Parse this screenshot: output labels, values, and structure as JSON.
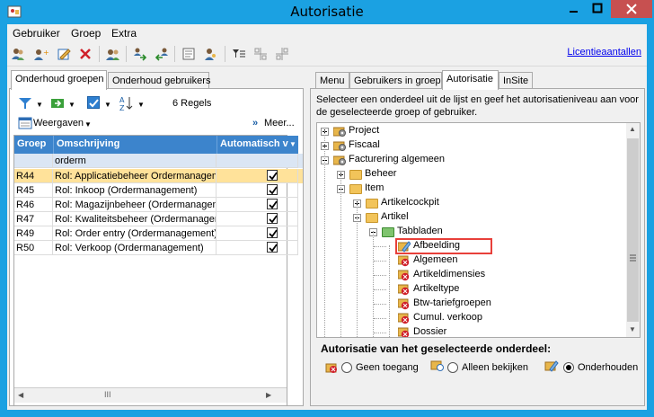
{
  "window": {
    "title": "Autorisatie"
  },
  "menu": {
    "items": [
      "Gebruiker",
      "Groep",
      "Extra"
    ]
  },
  "toolbar": {
    "license_link": "Licentieaantallen"
  },
  "left": {
    "tabs": [
      "Onderhoud groepen",
      "Onderhoud gebruikers"
    ],
    "row_count": "6 Regels",
    "views_label": "Weergaven",
    "more_label": "Meer...",
    "columns": [
      "Groep",
      "Omschrijving",
      "Automatisch v"
    ],
    "filter_value": "orderm",
    "rows": [
      {
        "code": "R44",
        "desc": "Rol: Applicatiebeheer Ordermanagement",
        "checked": true,
        "selected": true
      },
      {
        "code": "R45",
        "desc": "Rol: Inkoop (Ordermanagement)",
        "checked": true,
        "selected": false
      },
      {
        "code": "R46",
        "desc": "Rol: Magazijnbeheer (Ordermanagement)",
        "checked": true,
        "selected": false
      },
      {
        "code": "R47",
        "desc": "Rol: Kwaliteitsbeheer (Ordermanagement)",
        "checked": true,
        "selected": false
      },
      {
        "code": "R49",
        "desc": "Rol: Order entry (Ordermanagement)",
        "checked": true,
        "selected": false
      },
      {
        "code": "R50",
        "desc": "Rol: Verkoop (Ordermanagement)",
        "checked": true,
        "selected": false
      }
    ],
    "hscroll_grip": "III"
  },
  "right": {
    "tabs": [
      "Menu",
      "Gebruikers in groep",
      "Autorisatie",
      "InSite"
    ],
    "instruction": "Selecteer een onderdeel uit de lijst en geef het autorisatieniveau aan voor de geselecteerde groep of gebruiker.",
    "tree": [
      {
        "label": "Project",
        "kind": "gear"
      },
      {
        "label": "Fiscaal",
        "kind": "gear"
      },
      {
        "label": "Facturering algemeen",
        "kind": "gear"
      },
      {
        "label": "Beheer",
        "kind": "folder"
      },
      {
        "label": "Item",
        "kind": "folder"
      },
      {
        "label": "Artikelcockpit",
        "kind": "folder"
      },
      {
        "label": "Artikel",
        "kind": "folder"
      },
      {
        "label": "Tabbladen",
        "kind": "folder-open"
      },
      {
        "label": "Afbeelding",
        "kind": "edit"
      },
      {
        "label": "Algemeen",
        "kind": "deny"
      },
      {
        "label": "Artikeldimensies",
        "kind": "deny"
      },
      {
        "label": "Artikeltype",
        "kind": "deny"
      },
      {
        "label": "Btw-tariefgroepen",
        "kind": "deny"
      },
      {
        "label": "Cumul. verkoop",
        "kind": "deny"
      },
      {
        "label": "Dossier",
        "kind": "deny"
      }
    ],
    "auth_heading": "Autorisatie van het geselecteerde onderdeel:",
    "options": [
      {
        "label": "Geen toegang",
        "selected": false
      },
      {
        "label": "Alleen bekijken",
        "selected": false
      },
      {
        "label": "Onderhouden",
        "selected": true
      }
    ]
  },
  "colors": {
    "titlebar": "#1ba1e2",
    "grid_header": "#3c84cc",
    "selected_row": "#ffe29a",
    "highlight_border": "#e8403a"
  }
}
